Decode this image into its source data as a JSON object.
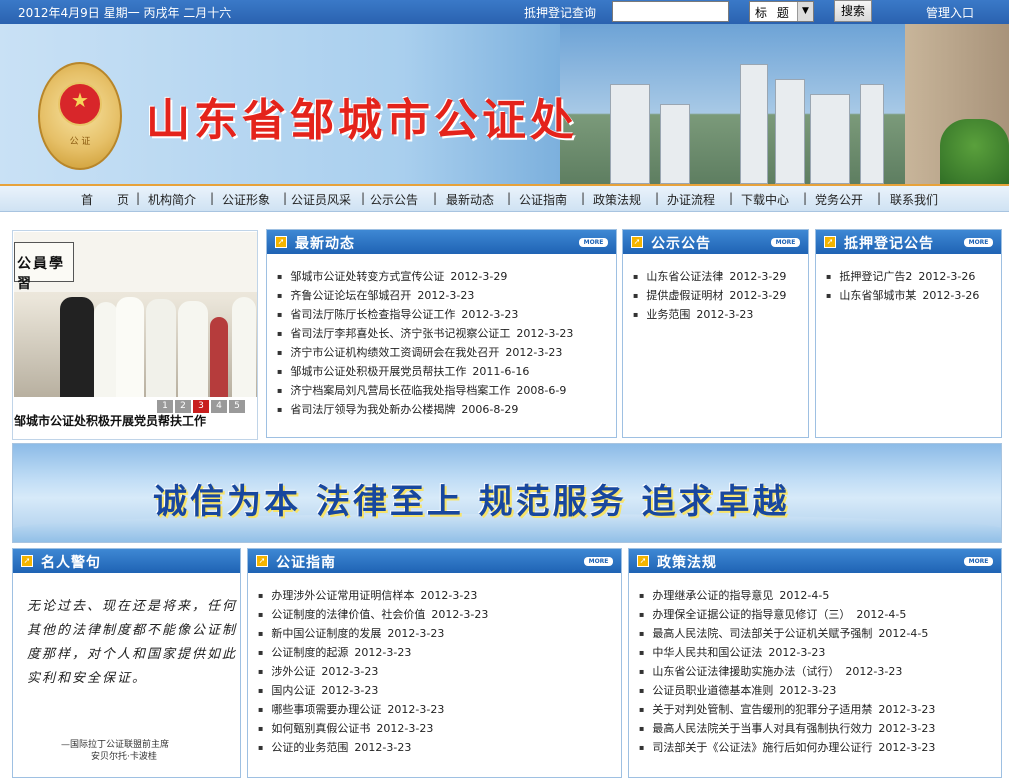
{
  "topbar": {
    "date": "2012年4月9日 星期一  丙戌年  二月十六",
    "pledge_query": "抵押登记查询",
    "search_value": "",
    "select_value": "标 题",
    "search_button": "搜索",
    "admin_login": "管理入口"
  },
  "banner": {
    "title": "山东省邹城市公证处",
    "emblem_text": "公 证"
  },
  "nav": {
    "items": [
      "首　　页",
      "机构简介",
      "公证形象",
      "公证员风采",
      "公示公告",
      "最新动态",
      "公证指南",
      "政策法规",
      "办证流程",
      "下载中心",
      "党务公开",
      "联系我们"
    ]
  },
  "slideshow": {
    "calendar_text": "公員學習",
    "pages": [
      "1",
      "2",
      "3",
      "4",
      "5"
    ],
    "active_page": "3",
    "caption": "邹城市公证处积极开展党员帮扶工作"
  },
  "panels": {
    "news": {
      "title": "最新动态",
      "more": "MORE",
      "items": [
        {
          "title": "邹城市公证处转变方式宣传公证",
          "date": "2012-3-29"
        },
        {
          "title": "齐鲁公证论坛在邹城召开",
          "date": "2012-3-23"
        },
        {
          "title": "省司法厅陈厅长检查指导公证工作",
          "date": "2012-3-23"
        },
        {
          "title": "省司法厅李邦喜处长、济宁张书记视察公证工",
          "date": "2012-3-23"
        },
        {
          "title": "济宁市公证机构绩效工资调研会在我处召开",
          "date": "2012-3-23"
        },
        {
          "title": "邹城市公证处积极开展党员帮扶工作",
          "date": "2011-6-16"
        },
        {
          "title": "济宁档案局刘凡营局长莅临我处指导档案工作",
          "date": "2008-6-9"
        },
        {
          "title": "省司法厅领导为我处新办公楼揭牌",
          "date": "2006-8-29"
        }
      ]
    },
    "notice": {
      "title": "公示公告",
      "more": "MORE",
      "items": [
        {
          "title": "山东省公证法律",
          "date": "2012-3-29"
        },
        {
          "title": "提供虚假证明材",
          "date": "2012-3-29"
        },
        {
          "title": "业务范围",
          "date": "2012-3-23"
        }
      ]
    },
    "pledge": {
      "title": "抵押登记公告",
      "more": "MORE",
      "items": [
        {
          "title": "抵押登记广告2",
          "date": "2012-3-26"
        },
        {
          "title": "山东省邹城市某",
          "date": "2012-3-26"
        }
      ]
    },
    "quote": {
      "title": "名人警句",
      "body": "无论过去、现在还是将来，任何其他的法律制度都不能像公证制度那样，对个人和国家提供如此实利和安全保证。",
      "source_line1": "—国际拉丁公证联盟前主席",
      "source_line2": "安贝尔托·卡波桂"
    },
    "guide": {
      "title": "公证指南",
      "more": "MORE",
      "items": [
        {
          "title": "办理涉外公证常用证明信样本",
          "date": "2012-3-23"
        },
        {
          "title": "公证制度的法律价值、社会价值",
          "date": "2012-3-23"
        },
        {
          "title": "新中国公证制度的发展",
          "date": "2012-3-23"
        },
        {
          "title": "公证制度的起源",
          "date": "2012-3-23"
        },
        {
          "title": "涉外公证",
          "date": "2012-3-23"
        },
        {
          "title": "国内公证",
          "date": "2012-3-23"
        },
        {
          "title": "哪些事项需要办理公证",
          "date": "2012-3-23"
        },
        {
          "title": "如何甄别真假公证书",
          "date": "2012-3-23"
        },
        {
          "title": "公证的业务范围",
          "date": "2012-3-23"
        }
      ]
    },
    "policy": {
      "title": "政策法规",
      "more": "MORE",
      "items": [
        {
          "title": "办理继承公证的指导意见",
          "date": "2012-4-5"
        },
        {
          "title": "办理保全证据公证的指导意见修订（三）",
          "date": "2012-4-5"
        },
        {
          "title": "最高人民法院、司法部关于公证机关赋予强制",
          "date": "2012-4-5"
        },
        {
          "title": "中华人民共和国公证法",
          "date": "2012-3-23"
        },
        {
          "title": "山东省公证法律援助实施办法（试行）",
          "date": "2012-3-23"
        },
        {
          "title": "公证员职业道德基本准则",
          "date": "2012-3-23"
        },
        {
          "title": "关于对判处管制、宣告缓刑的犯罪分子适用禁",
          "date": "2012-3-23"
        },
        {
          "title": "最高人民法院关于当事人对具有强制执行效力",
          "date": "2012-3-23"
        },
        {
          "title": "司法部关于《公证法》施行后如何办理公证行",
          "date": "2012-3-23"
        }
      ]
    }
  },
  "slogan": {
    "text": "诚信为本  法律至上  规范服务  追求卓越"
  },
  "colors": {
    "header_blue": "#1f63b4",
    "title_red": "#e4231b",
    "slogan_blue": "#18479e"
  }
}
